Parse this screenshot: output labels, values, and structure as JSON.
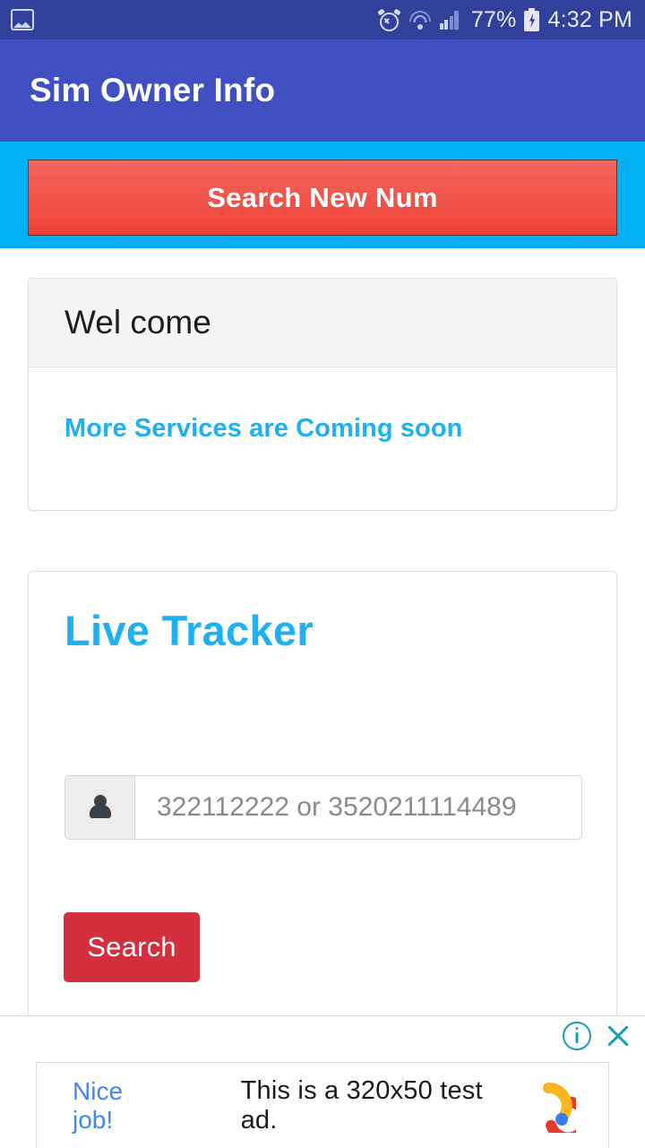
{
  "status_bar": {
    "icons_left": [
      "image-icon"
    ],
    "icons_right": [
      "alarm-icon",
      "wifi-icon",
      "signal-icon",
      "battery-charging-icon"
    ],
    "battery_percent": "77%",
    "time": "4:32 PM"
  },
  "app_bar": {
    "title": "Sim Owner Info",
    "background_color": "#4050C2"
  },
  "hero": {
    "band_color": "#03AFF5",
    "search_new_label": "Search New Num",
    "button_color": "#EE4237"
  },
  "welcome_panel": {
    "heading": "Wel come",
    "message": "More Services are Coming soon",
    "message_color": "#1FB0F0"
  },
  "tracker_panel": {
    "title": "Live Tracker",
    "title_color": "#1FB0F0",
    "input_placeholder": "322112222 or 3520211114489",
    "input_value": "",
    "input_icon": "person-icon",
    "search_label": "Search",
    "search_color": "#D32F3E"
  },
  "ad": {
    "info_icon": "info-icon",
    "close_icon": "close-icon",
    "cta": "Nice job!",
    "body": "This is a 320x50 test ad.",
    "logo": "admob-logo",
    "cta_color": "#4285F4"
  }
}
